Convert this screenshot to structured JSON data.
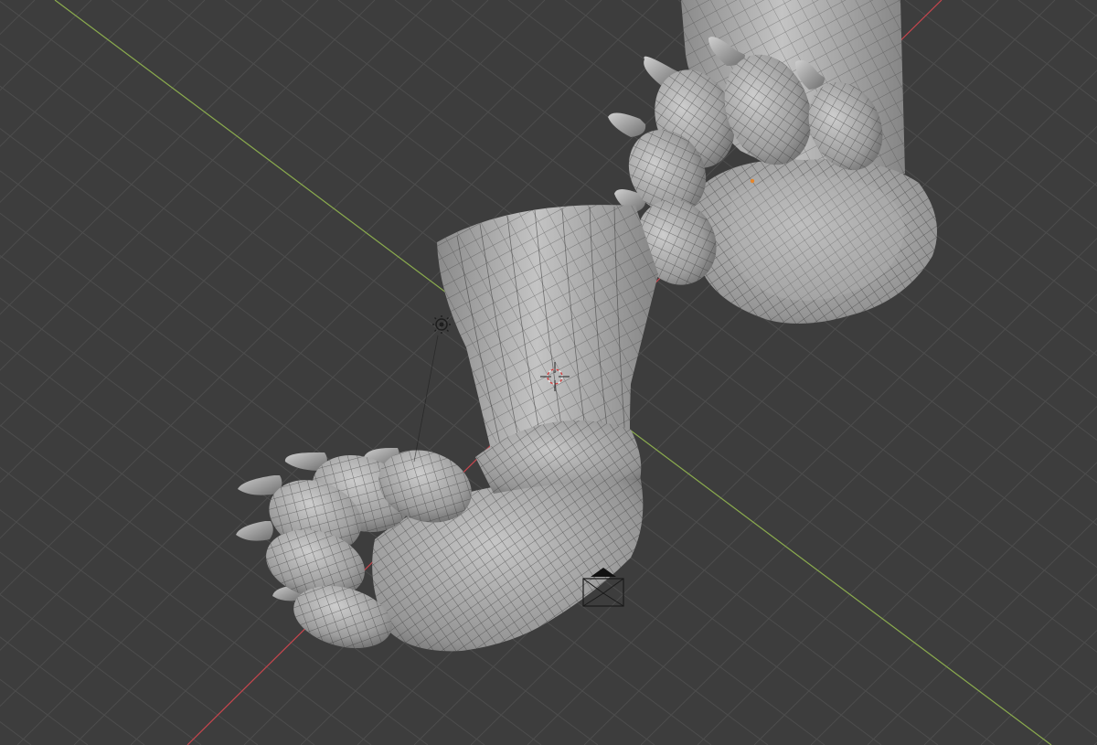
{
  "viewport": {
    "background": "#3d3d3d",
    "grid_color": "#4d4d4d",
    "axis_x_color": "#c6454d",
    "axis_y_color": "#8aab4d"
  },
  "mesh": {
    "base_color": "#a3a3a3",
    "shade_color": "#7a7a7a",
    "highlight_color": "#c9c9c9",
    "wire_color": "#333333",
    "claw_color": "#b8b8b8"
  },
  "icons": {
    "light": "light-icon",
    "camera": "camera-icon",
    "cursor": "3d-cursor-icon"
  }
}
